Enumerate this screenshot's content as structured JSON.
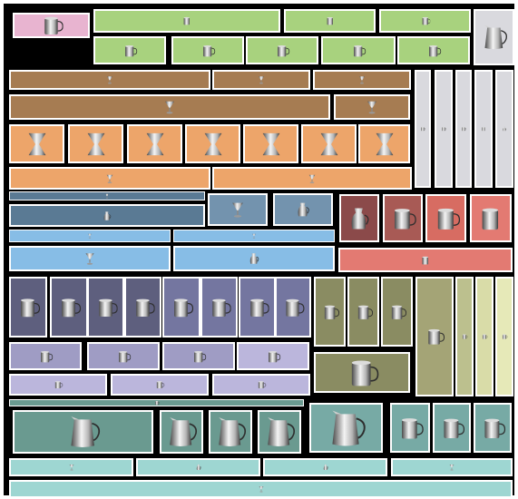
{
  "palette": {
    "pink": "#e8b4d0",
    "lime": "#a8d27e",
    "brown": "#a67c52",
    "orange": "#eda56a",
    "steel": "#5a7a94",
    "steel_light": "#7393ae",
    "sky": "#87bde6",
    "maroon": "#8b4a4a",
    "brick": "#a85a55",
    "salmon": "#d76c62",
    "salmon_light": "#e37a72",
    "slate": "#5e5f7e",
    "slate_mid": "#7476a0",
    "lavender": "#9f9cc4",
    "lavender_light": "#bbb6dc",
    "olive": "#8a8c62",
    "olive_light": "#a4a476",
    "khaki": "#bcc08e",
    "cream": "#d9dca8",
    "pale_yellow": "#e6e9b8",
    "teal": "#6a9a90",
    "teal_mid": "#77aaa5",
    "aqua": "#9ed6d2",
    "silver": "#d9d9de"
  },
  "icons": {
    "mug": "mug-icon",
    "pitcher": "pitcher-icon",
    "cup": "cup-icon",
    "goblet": "goblet-icon",
    "hourglass": "hourglass-vase-icon",
    "jug": "jug-icon"
  }
}
